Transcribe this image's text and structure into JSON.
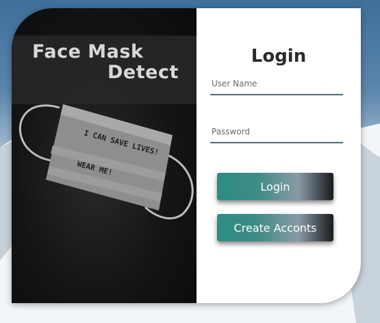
{
  "app": {
    "title_line1": "Face Mask",
    "title_line2": "Detect"
  },
  "image": {
    "mask_text_1": "I CAN SAVE LIVES!",
    "mask_text_2": "WEAR ME!"
  },
  "login": {
    "heading": "Login",
    "username_placeholder": "User Name",
    "password_placeholder": "Password",
    "login_button": "Login",
    "create_button": "Create Acconts"
  },
  "colors": {
    "accent": "#2b8d83",
    "field_underline": "#4c6b78",
    "left_panel": "#141414"
  }
}
